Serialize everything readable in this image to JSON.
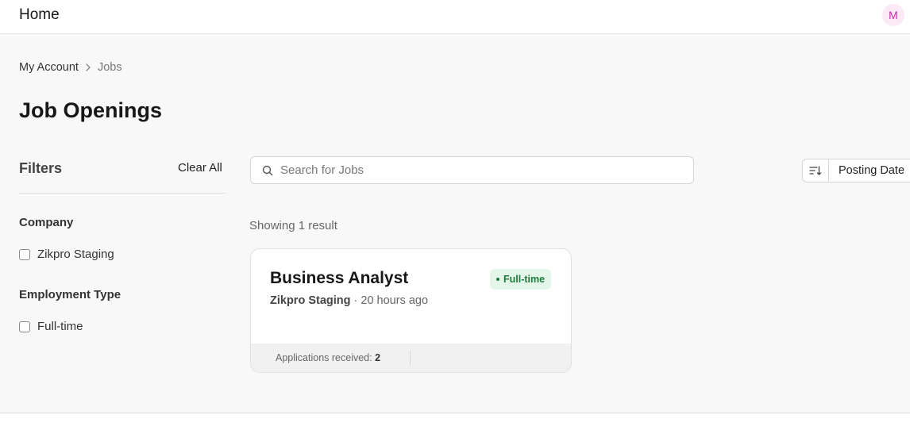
{
  "topbar": {
    "title": "Home",
    "avatar_initial": "M"
  },
  "breadcrumb": {
    "parent": "My Account",
    "current": "Jobs"
  },
  "page": {
    "title": "Job Openings"
  },
  "filters": {
    "title": "Filters",
    "clear_label": "Clear All",
    "groups": [
      {
        "title": "Company",
        "options": [
          {
            "label": "Zikpro Staging",
            "checked": false
          }
        ]
      },
      {
        "title": "Employment Type",
        "options": [
          {
            "label": "Full-time",
            "checked": false
          }
        ]
      }
    ]
  },
  "search": {
    "placeholder": "Search for Jobs",
    "value": ""
  },
  "sort": {
    "icon": "sort-descending-icon",
    "field_label": "Posting Date"
  },
  "results": {
    "count_text": "Showing 1 result"
  },
  "jobs": [
    {
      "title": "Business Analyst",
      "company": "Zikpro Staging",
      "posted": "· 20 hours ago",
      "type_badge": "Full-time",
      "applications_label": "Applications received:",
      "applications_count": "2"
    }
  ],
  "colors": {
    "accent_badge_bg": "#e4f5ea",
    "accent_badge_text": "#1f7a3c",
    "avatar_bg": "#fbeaf6",
    "avatar_text": "#c02ca4"
  }
}
